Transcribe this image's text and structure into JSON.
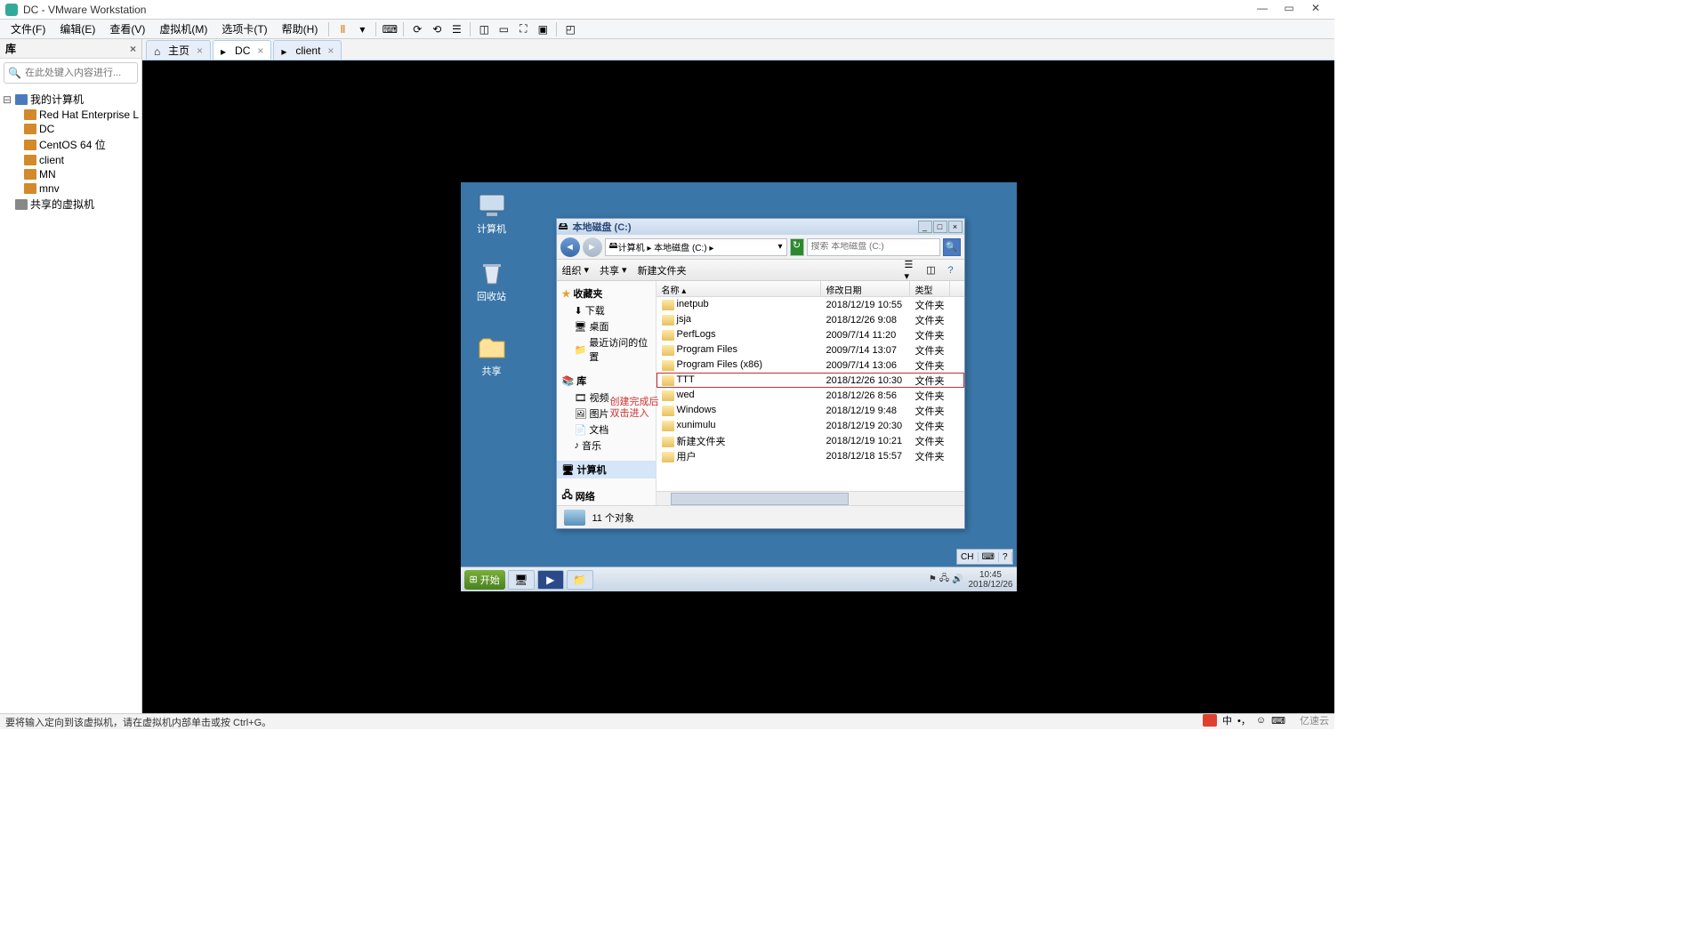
{
  "app": {
    "title": "DC - VMware Workstation"
  },
  "menu": {
    "items": [
      "文件(F)",
      "编辑(E)",
      "查看(V)",
      "虚拟机(M)",
      "选项卡(T)",
      "帮助(H)"
    ]
  },
  "library": {
    "title": "库",
    "search_placeholder": "在此处键入内容进行...",
    "root": "我的计算机",
    "vms": [
      "Red Hat Enterprise L",
      "DC",
      "CentOS 64 位",
      "client",
      "MN",
      "mnv"
    ],
    "shared": "共享的虚拟机"
  },
  "tabs": [
    {
      "label": "主页",
      "icon": "home"
    },
    {
      "label": "DC",
      "icon": "vm",
      "active": true
    },
    {
      "label": "client",
      "icon": "vm"
    }
  ],
  "desktop": {
    "icons": [
      {
        "label": "计算机",
        "kind": "computer"
      },
      {
        "label": "回收站",
        "kind": "recycle"
      },
      {
        "label": "共享",
        "kind": "folder"
      }
    ]
  },
  "explorer": {
    "title": "本地磁盘 (C:)",
    "breadcrumb": "计算机 ▸ 本地磁盘 (C:) ▸",
    "search_placeholder": "搜索 本地磁盘 (C:)",
    "toolbar": {
      "org": "组织",
      "share": "共享",
      "new": "新建文件夹"
    },
    "side": {
      "fav": {
        "label": "收藏夹",
        "items": [
          "下载",
          "桌面",
          "最近访问的位置"
        ]
      },
      "lib": {
        "label": "库",
        "items": [
          "视频",
          "图片",
          "文档",
          "音乐"
        ]
      },
      "comp": "计算机",
      "net": "网络"
    },
    "columns": {
      "name": "名称",
      "date": "修改日期",
      "type": "类型"
    },
    "rows": [
      {
        "name": "inetpub",
        "date": "2018/12/19 10:55",
        "type": "文件夹"
      },
      {
        "name": "jsja",
        "date": "2018/12/26 9:08",
        "type": "文件夹"
      },
      {
        "name": "PerfLogs",
        "date": "2009/7/14 11:20",
        "type": "文件夹"
      },
      {
        "name": "Program Files",
        "date": "2009/7/14 13:07",
        "type": "文件夹"
      },
      {
        "name": "Program Files (x86)",
        "date": "2009/7/14 13:06",
        "type": "文件夹"
      },
      {
        "name": "TTT",
        "date": "2018/12/26 10:30",
        "type": "文件夹",
        "hl": true
      },
      {
        "name": "wed",
        "date": "2018/12/26 8:56",
        "type": "文件夹"
      },
      {
        "name": "Windows",
        "date": "2018/12/19 9:48",
        "type": "文件夹"
      },
      {
        "name": "xunimulu",
        "date": "2018/12/19 20:30",
        "type": "文件夹"
      },
      {
        "name": "新建文件夹",
        "date": "2018/12/19 10:21",
        "type": "文件夹"
      },
      {
        "name": "用户",
        "date": "2018/12/18 15:57",
        "type": "文件夹"
      }
    ],
    "status": "11 个对象",
    "annotation": {
      "l1": "创建完成后",
      "l2": "双击进入"
    }
  },
  "guest_taskbar": {
    "start": "开始",
    "lang": "CH",
    "time": "10:45",
    "date": "2018/12/26"
  },
  "status": "要将输入定向到该虚拟机，请在虚拟机内部单击或按 Ctrl+G。",
  "host_tray": {
    "brand": "亿速云",
    "ime": "中"
  }
}
